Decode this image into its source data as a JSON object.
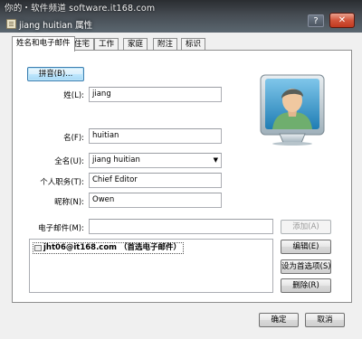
{
  "window": {
    "watermark": "你的・软件频道 software.it168.com",
    "title": "jiang huitian 属性",
    "help_glyph": "?",
    "close_glyph": "✕"
  },
  "tabs": [
    {
      "label": "姓名和电子邮件",
      "active": true
    },
    {
      "label": "住宅"
    },
    {
      "label": "工作"
    },
    {
      "label": "家庭"
    },
    {
      "label": "附注"
    },
    {
      "label": "标识"
    }
  ],
  "form": {
    "phonetic_button": "拼音(B)...",
    "last_name": {
      "label": "姓(L):",
      "value": "jiang"
    },
    "first_name": {
      "label": "名(F):",
      "value": "huitian"
    },
    "full_name": {
      "label": "全名(U):",
      "value": "jiang huitian"
    },
    "title": {
      "label": "个人职务(T):",
      "value": "Chief Editor"
    },
    "nickname": {
      "label": "昵称(N):",
      "value": "Owen"
    },
    "email": {
      "label": "电子邮件(M):",
      "value": ""
    }
  },
  "email_list": {
    "items": [
      {
        "text": "jht06@it168.com （首选电子邮件）"
      }
    ]
  },
  "side_buttons": {
    "add": "添加(A)",
    "edit": "编辑(E)",
    "set_default": "设为首选项(S)",
    "delete": "删除(R)"
  },
  "footer": {
    "ok": "确定",
    "cancel": "取消"
  },
  "colors": {
    "titlebar": "#454b52",
    "close": "#c0391f",
    "avatar_bg": "#2b8fc4",
    "avatar_skin": "#f0c8a0",
    "avatar_hair": "#5a5e58",
    "avatar_shirt": "#6fae6e"
  }
}
